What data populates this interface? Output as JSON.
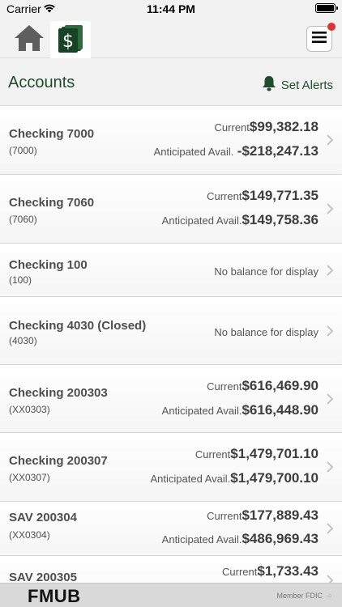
{
  "status_bar": {
    "carrier": "Carrier",
    "time": "11:44 PM"
  },
  "nav": {
    "home_icon": "home-icon",
    "accounts_icon": "dollar-bills-icon",
    "menu_icon": "hamburger-menu-icon"
  },
  "header": {
    "title": "Accounts",
    "alerts_label": "Set Alerts",
    "alerts_icon": "bell-icon"
  },
  "accounts": [
    {
      "name": "Checking 7000",
      "number": "(7000)",
      "current_label": "Current",
      "current": "$99,382.18",
      "anticipated_label": "Anticipated Avail.",
      "anticipated": "-$218,247.13"
    },
    {
      "name": "Checking 7060",
      "number": "(7060)",
      "current_label": "Current",
      "current": "$149,771.35",
      "anticipated_label": "Anticipated Avail.",
      "anticipated": "$149,758.36"
    },
    {
      "name": "Checking 100",
      "number": "(100)",
      "no_balance": "No balance for display"
    },
    {
      "name": "Checking 4030 (Closed)",
      "number": "(4030)",
      "no_balance": "No balance for display"
    },
    {
      "name": "Checking 200303",
      "number": "(XX0303)",
      "current_label": "Current",
      "current": "$616,469.90",
      "anticipated_label": "Anticipated Avail.",
      "anticipated": "$616,448.90"
    },
    {
      "name": "Checking 200307",
      "number": "(XX0307)",
      "current_label": "Current",
      "current": "$1,479,701.10",
      "anticipated_label": "Anticipated Avail.",
      "anticipated": "$1,479,700.10"
    },
    {
      "name": "SAV 200304",
      "number": "(XX0304)",
      "current_label": "Current",
      "current": "$177,889.43",
      "anticipated_label": "Anticipated Avail.",
      "anticipated": "$486,969.43"
    },
    {
      "name": "SAV 200305",
      "current_label": "Current",
      "current": "$1,733.43"
    }
  ],
  "footer": {
    "brand": "FMUB",
    "fdic": "Member FDIC"
  },
  "colors": {
    "brand_green": "#1d4d2c",
    "alert_dot": "#e0322f"
  }
}
